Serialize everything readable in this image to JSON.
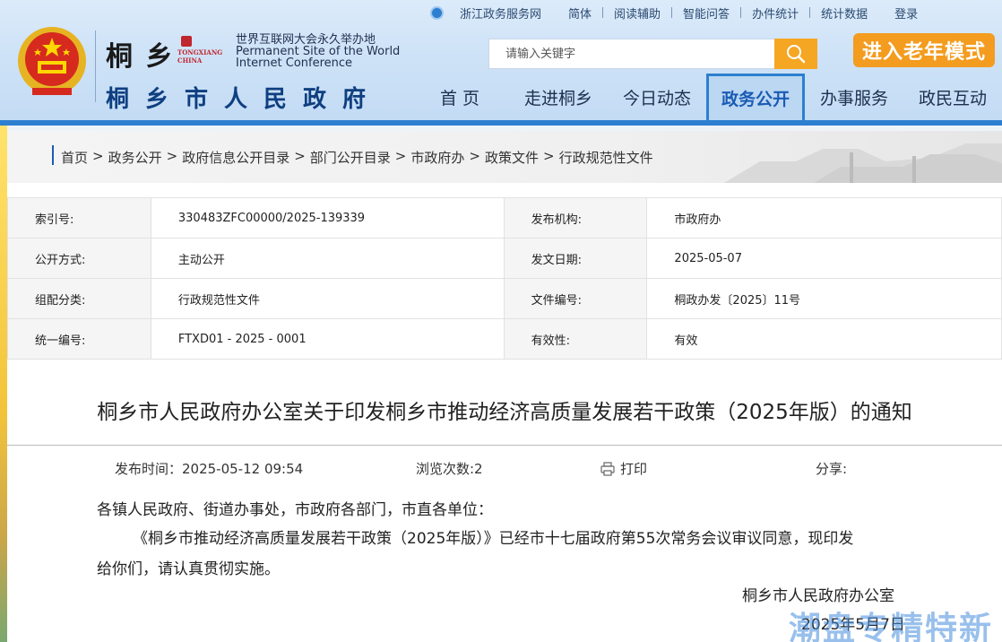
{
  "header": {
    "calligraphy": "桐 乡",
    "tx_brand_line1": "TONGXIANG",
    "tx_brand_line2": "CHINA",
    "wic_cn": "世界互联网大会永久举办地",
    "wic_en1": "Permanent Site of the World",
    "wic_en2": "Internet Conference",
    "gov_name": "桐乡市人民政府",
    "search_placeholder": "请输入关键字",
    "elder_mode": "进入老年模式"
  },
  "toplinks": [
    "浙江政务服务网",
    "简体",
    "阅读辅助",
    "智能问答",
    "办件统计",
    "统计数据",
    "登录"
  ],
  "nav": [
    "首 页",
    "走进桐乡",
    "今日动态",
    "政务公开",
    "办事服务",
    "政民互动"
  ],
  "breadcrumb": [
    "首页",
    "政务公开",
    "政府信息公开目录",
    "部门公开目录",
    "市政府办",
    "政策文件",
    "行政规范性文件"
  ],
  "meta": [
    [
      "索引号:",
      "330483ZFC00000/2025-139339",
      "发布机构:",
      "市政府办"
    ],
    [
      "公开方式:",
      "主动公开",
      "发文日期:",
      "2025-05-07"
    ],
    [
      "组配分类:",
      "行政规范性文件",
      "文件编号:",
      "桐政办发〔2025〕11号"
    ],
    [
      "统一编号:",
      "FTXD01 - 2025 - 0001",
      "有效性:",
      "有效"
    ]
  ],
  "doc": {
    "title": "桐乡市人民政府办公室关于印发桐乡市推动经济高质量发展若干政策（2025年版）的通知",
    "publish_time": "发布时间：2025-05-12  09:54",
    "views": "浏览次数:2",
    "print": "打印",
    "share": "分享:",
    "salutation": "各镇人民政府、街道办事处，市政府各部门，市直各单位：",
    "para_line1": "《桐乡市推动经济高质量发展若干政策（2025年版）》已经市十七届政府第55次常务会议审议同意，现印发",
    "para_line2": "给你们，请认真贯彻实施。",
    "signature": "桐乡市人民政府办公室",
    "date": "2025年5月7日"
  },
  "watermark": "潮盘专精特新"
}
